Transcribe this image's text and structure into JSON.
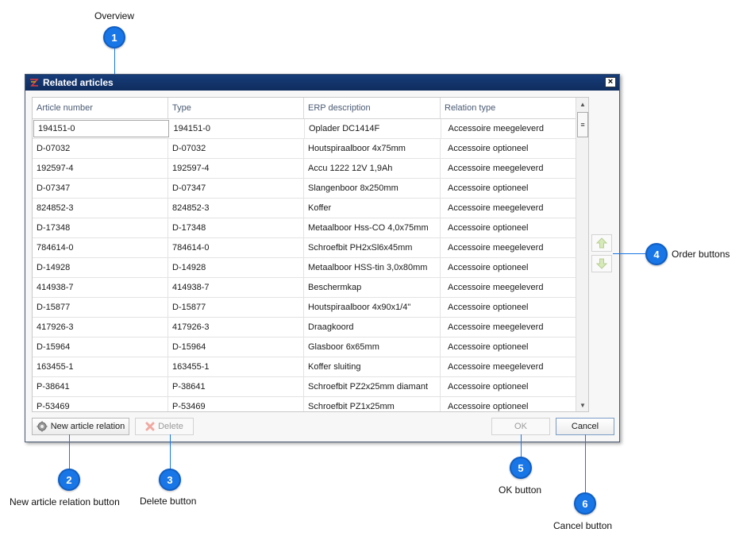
{
  "callouts": {
    "overview": {
      "number": "1",
      "label": "Overview"
    },
    "new_relation": {
      "number": "2",
      "label": "New article relation button"
    },
    "delete": {
      "number": "3",
      "label": "Delete button"
    },
    "order": {
      "number": "4",
      "label": "Order buttons"
    },
    "ok": {
      "number": "5",
      "label": "OK button"
    },
    "cancel": {
      "number": "6",
      "label": "Cancel button"
    }
  },
  "dialog": {
    "title": "Related articles",
    "close": "×"
  },
  "grid": {
    "columns": [
      "Article number",
      "Type",
      "ERP description",
      "Relation type"
    ],
    "rows": [
      [
        "194151-0",
        "194151-0",
        "Oplader DC1414F",
        "Accessoire meegeleverd"
      ],
      [
        "D-07032",
        "D-07032",
        "Houtspiraalboor 4x75mm",
        "Accessoire optioneel"
      ],
      [
        "192597-4",
        "192597-4",
        "Accu 1222 12V 1,9Ah",
        "Accessoire meegeleverd"
      ],
      [
        "D-07347",
        "D-07347",
        "Slangenboor 8x250mm",
        "Accessoire optioneel"
      ],
      [
        "824852-3",
        "824852-3",
        "Koffer",
        "Accessoire meegeleverd"
      ],
      [
        "D-17348",
        "D-17348",
        "Metaalboor Hss-CO 4,0x75mm",
        "Accessoire optioneel"
      ],
      [
        "784614-0",
        "784614-0",
        "Schroefbit PH2xSl6x45mm",
        "Accessoire meegeleverd"
      ],
      [
        "D-14928",
        "D-14928",
        "Metaalboor HSS-tin 3,0x80mm",
        "Accessoire optioneel"
      ],
      [
        "414938-7",
        "414938-7",
        "Beschermkap",
        "Accessoire meegeleverd"
      ],
      [
        "D-15877",
        "D-15877",
        "Houtspiraalboor 4x90x1/4\"",
        "Accessoire optioneel"
      ],
      [
        "417926-3",
        "417926-3",
        "Draagkoord",
        "Accessoire meegeleverd"
      ],
      [
        "D-15964",
        "D-15964",
        "Glasboor 6x65mm",
        "Accessoire optioneel"
      ],
      [
        "163455-1",
        "163455-1",
        "Koffer sluiting",
        "Accessoire meegeleverd"
      ],
      [
        "P-38641",
        "P-38641",
        "Schroefbit PZ2x25mm diamant",
        "Accessoire optioneel"
      ],
      [
        "P-53469",
        "P-53469",
        "Schroefbit PZ1x25mm",
        "Accessoire optioneel"
      ]
    ]
  },
  "buttons": {
    "new_relation": "New article relation",
    "delete": "Delete",
    "ok": "OK",
    "cancel": "Cancel"
  },
  "icons": {
    "scroll_up": "scroll-up-icon",
    "scroll_down": "scroll-down-icon",
    "move_up": "move-up-icon",
    "move_down": "move-down-icon"
  },
  "colors": {
    "accent": "#1976e6",
    "titlebar": "#173d7a",
    "header_text": "#4a5a73"
  }
}
